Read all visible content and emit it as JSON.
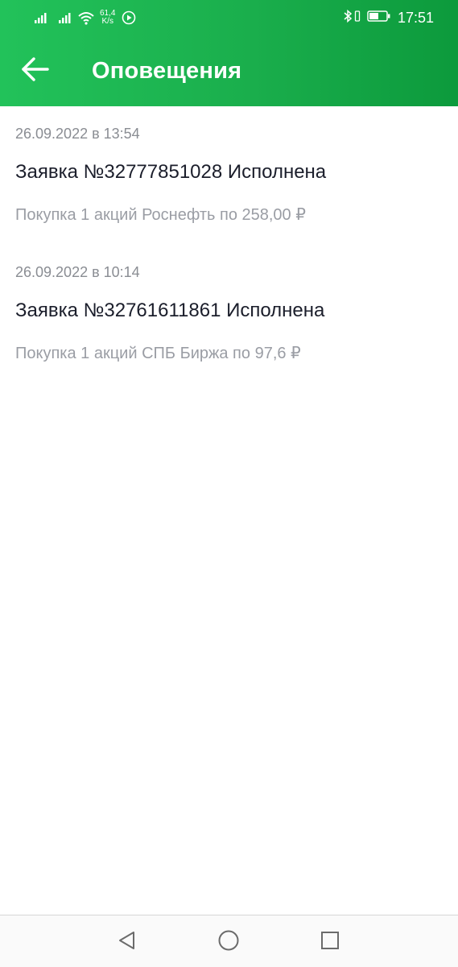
{
  "status_bar": {
    "net_speed_value": "61,4",
    "net_speed_unit": "K/s",
    "time": "17:51"
  },
  "header": {
    "title": "Оповещения"
  },
  "notifications": [
    {
      "date": "26.09.2022 в 13:54",
      "title": "Заявка №32777851028 Исполнена",
      "description": "Покупка 1 акций Роснефть по 258,00 ₽"
    },
    {
      "date": "26.09.2022 в 10:14",
      "title": "Заявка №32761611861 Исполнена",
      "description": "Покупка 1 акций СПБ Биржа по 97,6 ₽"
    }
  ],
  "colors": {
    "header_start": "#22c25a",
    "header_end": "#0c9a3c",
    "title_text": "#1b1e2b",
    "secondary_text": "#8a8d93"
  },
  "icons": {
    "back": "arrow-left-icon",
    "nav_back": "triangle-back-icon",
    "nav_home": "circle-home-icon",
    "nav_recents": "square-recents-icon"
  }
}
